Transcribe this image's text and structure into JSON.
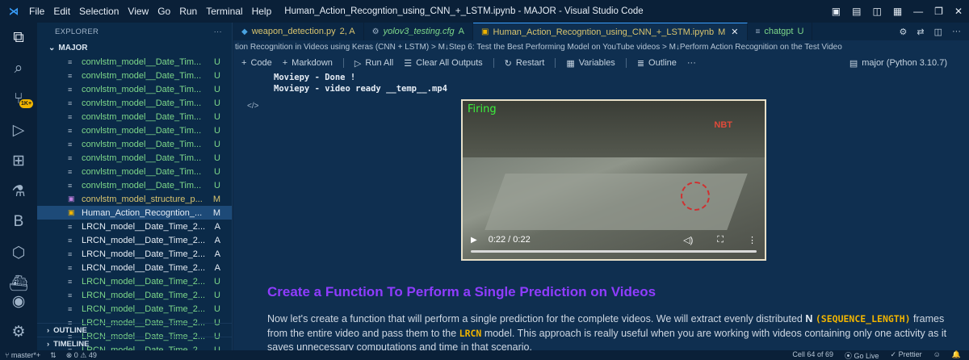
{
  "titlebar": {
    "menu": [
      "File",
      "Edit",
      "Selection",
      "View",
      "Go",
      "Run",
      "Terminal",
      "Help"
    ],
    "window_title": "Human_Action_Recogntion_using_CNN_+_LSTM.ipynb - MAJOR - Visual Studio Code"
  },
  "activity": {
    "badge": "1K+"
  },
  "sidebar": {
    "header": "EXPLORER",
    "folder": "MAJOR",
    "files": [
      {
        "name": "convlstm_model__Date_Tim...",
        "status": "U",
        "color": "green",
        "icon": "file-icon"
      },
      {
        "name": "convlstm_model__Date_Tim...",
        "status": "U",
        "color": "green",
        "icon": "file-icon"
      },
      {
        "name": "convlstm_model__Date_Tim...",
        "status": "U",
        "color": "green",
        "icon": "file-icon"
      },
      {
        "name": "convlstm_model__Date_Tim...",
        "status": "U",
        "color": "green",
        "icon": "file-icon"
      },
      {
        "name": "convlstm_model__Date_Tim...",
        "status": "U",
        "color": "green",
        "icon": "file-icon"
      },
      {
        "name": "convlstm_model__Date_Tim...",
        "status": "U",
        "color": "green",
        "icon": "file-icon"
      },
      {
        "name": "convlstm_model__Date_Tim...",
        "status": "U",
        "color": "green",
        "icon": "file-icon"
      },
      {
        "name": "convlstm_model__Date_Tim...",
        "status": "U",
        "color": "green",
        "icon": "file-icon"
      },
      {
        "name": "convlstm_model__Date_Tim...",
        "status": "U",
        "color": "green",
        "icon": "file-icon"
      },
      {
        "name": "convlstm_model__Date_Tim...",
        "status": "U",
        "color": "green",
        "icon": "file-icon"
      },
      {
        "name": "convlstm_model_structure_p...",
        "status": "M",
        "color": "ylw",
        "icon": "image-icon"
      },
      {
        "name": "Human_Action_Recogntion_...",
        "status": "M",
        "color": "white",
        "icon": "notebook-icon",
        "selected": true
      },
      {
        "name": "LRCN_model__Date_Time_2...",
        "status": "A",
        "color": "white",
        "icon": "file-icon"
      },
      {
        "name": "LRCN_model__Date_Time_2...",
        "status": "A",
        "color": "white",
        "icon": "file-icon"
      },
      {
        "name": "LRCN_model__Date_Time_2...",
        "status": "A",
        "color": "white",
        "icon": "file-icon"
      },
      {
        "name": "LRCN_model__Date_Time_2...",
        "status": "A",
        "color": "white",
        "icon": "file-icon"
      },
      {
        "name": "LRCN_model__Date_Time_2...",
        "status": "U",
        "color": "green",
        "icon": "file-icon"
      },
      {
        "name": "LRCN_model__Date_Time_2...",
        "status": "U",
        "color": "green",
        "icon": "file-icon"
      },
      {
        "name": "LRCN_model__Date_Time_2...",
        "status": "U",
        "color": "green",
        "icon": "file-icon"
      },
      {
        "name": "LRCN_model__Date_Time_2...",
        "status": "U",
        "color": "green",
        "icon": "file-icon"
      },
      {
        "name": "LRCN_model__Date_Time_2...",
        "status": "U",
        "color": "green",
        "icon": "file-icon"
      },
      {
        "name": "LRCN_model__Date_Time_2...",
        "status": "U",
        "color": "green",
        "icon": "file-icon"
      },
      {
        "name": "LRCN_model__Date_Time_2...",
        "status": "U",
        "color": "green",
        "icon": "file-icon"
      }
    ],
    "outline": "OUTLINE",
    "timeline": "TIMELINE"
  },
  "tabs": [
    {
      "label": "weapon_detection.py",
      "meta": "2, A",
      "icon": "python-icon",
      "active": false
    },
    {
      "label": "yolov3_testing.cfg",
      "meta": "A",
      "icon": "gear-icon",
      "active": false
    },
    {
      "label": "Human_Action_Recogntion_using_CNN_+_LSTM.ipynb",
      "meta": "M",
      "icon": "notebook-icon",
      "active": true
    },
    {
      "label": "chatgpt",
      "meta": "U",
      "icon": "file-icon",
      "active": false
    }
  ],
  "breadcrumbs": "tion Recognition in Videos using Keras (CNN + LSTM) > M↓Step 6: Test the Best Performing Model on YouTube videos > M↓Perform Action Recognition on the Test Video",
  "toolbar": {
    "code": "Code",
    "markdown": "Markdown",
    "run_all": "Run All",
    "clear": "Clear All Outputs",
    "restart": "Restart",
    "variables": "Variables",
    "outline": "Outline",
    "more": "···",
    "kernel": "major (Python 3.10.7)"
  },
  "output": {
    "line1": "Moviepy - Done !",
    "line2": "Moviepy - video ready __temp__.mp4",
    "code_marker": "</>"
  },
  "video": {
    "label": "Firing",
    "watermark": "NBT",
    "time": "0:22 / 0:22",
    "progress": 1.0
  },
  "markdown": {
    "heading": "Create a Function To Perform a Single Prediction on Videos",
    "p1": "Now let's create a function that will perform a single prediction for the complete videos. We will extract evenly distributed ",
    "n": "N",
    "seq": "(SEQUENCE_LENGTH)",
    "p2": " frames from the entire video and pass them to the ",
    "lrcn": "LRCN",
    "p3": " model. This approach is really useful when you are working with videos containing only one activity as it saves unnecessary computations and time in that scenario."
  },
  "status": {
    "branch": "master*+",
    "errors": "0",
    "warnings": "49",
    "cell": "Cell 64 of 69",
    "golive": "Go Live",
    "prettier": "Prettier"
  },
  "colors": {
    "heading": "#8f3cff",
    "keyword": "#f0b400",
    "untracked": "#7dd88a",
    "modified": "#d9c46e"
  }
}
